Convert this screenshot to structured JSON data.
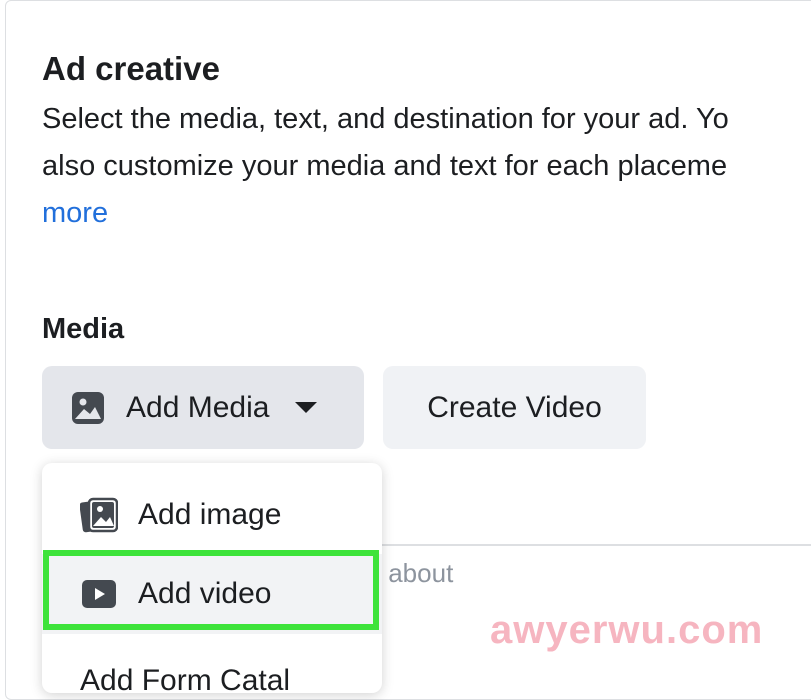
{
  "ad_creative": {
    "title": "Ad creative",
    "description_line1": "Select the media, text, and destination for your ad. Yo",
    "description_line2": "also customize your media and text for each placeme",
    "learn_more_link": "more"
  },
  "media": {
    "label": "Media",
    "add_media_button": "Add Media",
    "create_video_button": "Create Video",
    "hint_text": "s about"
  },
  "dropdown": {
    "items": [
      {
        "label": "Add image",
        "icon": "images-icon"
      },
      {
        "label": "Add video",
        "icon": "video-play-icon"
      },
      {
        "label": "Add Form Catal",
        "icon": ""
      }
    ],
    "highlighted_item": "Add video",
    "highlight_color": "#3ee33a"
  },
  "colors": {
    "link": "#216fdb",
    "button_bg": "#e4e6eb",
    "button_secondary_bg": "#f0f2f5"
  },
  "watermark": "awyerwu.com"
}
